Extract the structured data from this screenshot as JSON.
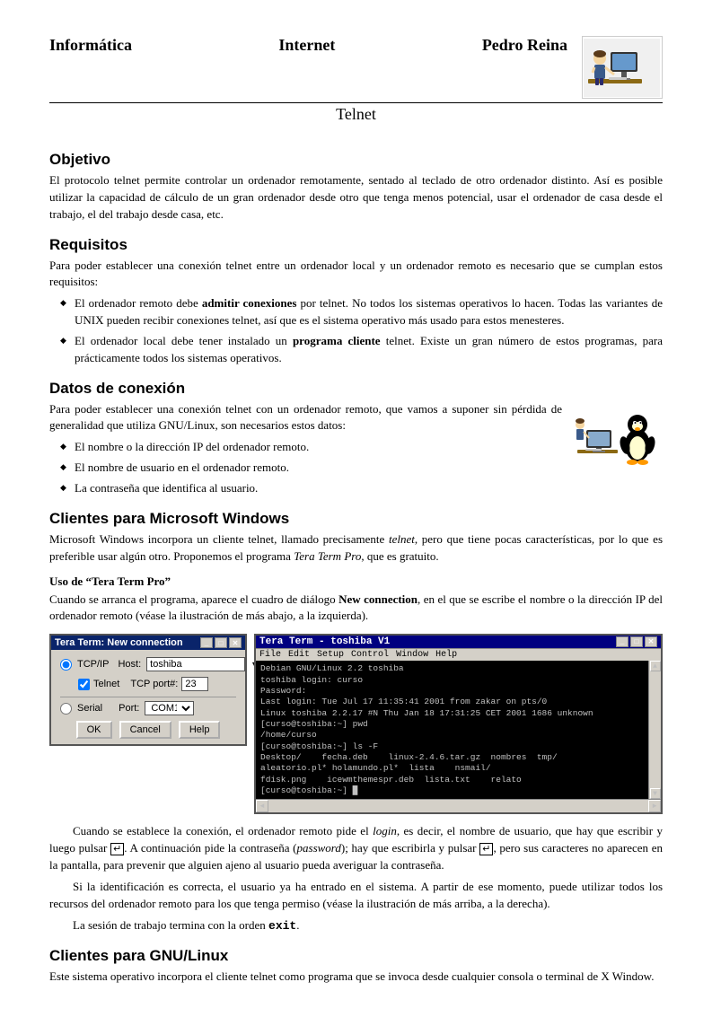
{
  "header": {
    "left": "Informática",
    "center": "Internet",
    "right": "Pedro Reina",
    "title": "Telnet"
  },
  "sections": {
    "objetivo": {
      "title": "Objetivo",
      "body": "El protocolo telnet permite controlar un ordenador remotamente, sentado al teclado de otro ordenador distinto. Así es posible utilizar la capacidad de cálculo de un gran ordenador desde otro que tenga menos potencial, usar el ordenador de casa desde el trabajo, el del trabajo desde casa, etc."
    },
    "requisitos": {
      "title": "Requisitos",
      "intro": "Para poder establecer una conexión telnet entre un ordenador local y un ordenador remoto es necesario que se cumplan estos requisitos:",
      "items": [
        "El ordenador remoto debe admitir conexiones por telnet. No todos los sistemas operativos lo hacen. Todas las variantes de UNIX pueden recibir conexiones telnet, así que es el sistema operativo más usado para estos menesteres.",
        "El ordenador local debe tener instalado un programa cliente telnet. Existe un gran número de estos programas, para prácticamente todos los sistemas operativos."
      ],
      "bold1": "admitir conexiones",
      "bold2": "programa cliente"
    },
    "datos": {
      "title": "Datos de conexión",
      "body": "Para poder establecer una conexión telnet con un ordenador remoto, que vamos a suponer sin pérdida de generalidad que utiliza GNU/Linux, son necesarios estos datos:",
      "items": [
        "El nombre o la dirección IP del ordenador remoto.",
        "El nombre de usuario en el ordenador remoto.",
        "La contraseña que identifica al usuario."
      ]
    },
    "clientes_windows": {
      "title": "Clientes para Microsoft Windows",
      "body1": "Microsoft Windows incorpora un cliente telnet, llamado precisamente ",
      "italic1": "telnet",
      "body2": ", pero que tiene pocas características, por lo que es preferible usar algún otro. Proponemos el programa ",
      "italic2": "Tera Term Pro",
      "body3": ", que es gratuito.",
      "subsection": "Uso de \"Tera Term Pro\"",
      "uso_body": "Cuando se arranca el programa, aparece el cuadro de diálogo ",
      "bold_new_connection": "New connection",
      "uso_body2": ", en el que se escribe el nombre o la dirección IP del ordenador remoto (véase la ilustración de más abajo, a la izquierda).",
      "para2_a": "Cuando se establece la conexión, el ordenador remoto pide el ",
      "italic_login": "login",
      "para2_b": ", es decir, el nombre de usuario, que hay que escribir y luego pulsar ",
      "key_enter": "↵",
      "para2_c": ". A continuación pide la contraseña (",
      "italic_password": "password",
      "para2_d": "); hay que escribirla y pulsar ",
      "key_enter2": "↵",
      "para2_e": ", pero sus caracteres no aparecen en la pantalla, para prevenir que alguien ajeno al usuario pueda averiguar la contraseña.",
      "para3_a": "Si la identificación es correcta, el usuario ya ha entrado en el sistema. A partir de ese momento, puede utilizar todos los recursos del ordenador remoto para los que tenga permiso (véase la ilustración de más arriba, a la derecha).",
      "para4": "La sesión de trabajo termina con la orden ",
      "exit_code": "exit",
      "para4_end": "."
    },
    "clientes_linux": {
      "title": "Clientes para GNU/Linux",
      "body": "Este sistema operativo incorpora el cliente telnet como programa que se invoca desde cualquier consola o terminal de X Window."
    }
  },
  "tera_term_window": {
    "title": "Tera Term: New connection",
    "tcp_label": "TCP/IP",
    "host_label": "Host:",
    "host_value": "toshiba",
    "telnet_label": "Telnet",
    "tcp_port_label": "TCP port#:",
    "tcp_port_value": "23",
    "serial_label": "Serial",
    "port_label": "Port:",
    "port_value": "COM1",
    "btn_ok": "OK",
    "btn_cancel": "Cancel",
    "btn_help": "Help"
  },
  "terminal_window": {
    "title": "Tera Term - toshiba V1",
    "menu": [
      "File",
      "Edit",
      "Setup",
      "Control",
      "Window",
      "Help"
    ],
    "lines": [
      "Debian GNU/Linux 2.2 toshiba",
      "toshiba login: curso",
      "Password:",
      "Last login: Tue Jul 17 11:35:41 2001 from zakar on pts/0",
      "Linux toshiba 2.2.17 #N Thu Jan 18 17:31:25 CET 2001 1686 unknown",
      "[curso@toshiba:~] pwd",
      "/home/curso",
      "[curso@toshiba:~] ls -F",
      "Desktop/    fecha.deb    linux-2.4.6.tar.gz  nombres  tmp/",
      "aleatorio.pl* holamundo.pl*  lista    nsmail/",
      "fdisk.png    icewmthemespr.deb  lista.txt    relato",
      "[curso@toshiba:~] _"
    ]
  }
}
